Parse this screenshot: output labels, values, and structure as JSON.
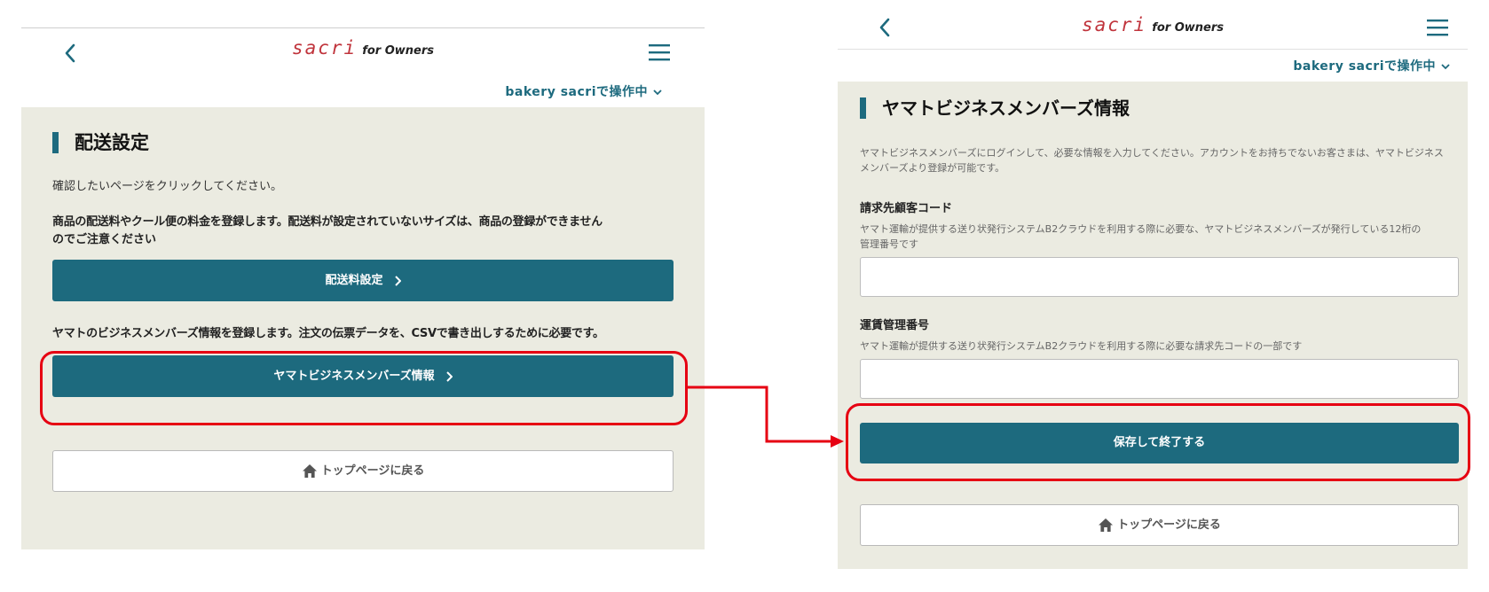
{
  "colors": {
    "accent": "#1d6a7e",
    "brand": "#c0343c",
    "highlight": "#e60012",
    "content_bg": "#ebebe1"
  },
  "header": {
    "brand": "sacri",
    "brand_sub": "for Owners"
  },
  "store": {
    "label": "bakery sacriで操作中"
  },
  "left": {
    "title": "配送設定",
    "instruction": "確認したいページをクリックしてください。",
    "shipping_note_line1": "商品の配送料やクール便の料金を登録します。配送料が設定されていないサイズは、商品の登録ができません",
    "shipping_note_line2": "のでご注意ください",
    "shipping_button": "配送料設定",
    "yamato_note": "ヤマトのビジネスメンバーズ情報を登録します。注文の伝票データを、CSVで書き出しするために必要です。",
    "yamato_button": "ヤマトビジネスメンバーズ情報",
    "top_button": "トップページに戻る"
  },
  "right": {
    "title": "ヤマトビジネスメンバーズ情報",
    "description_line1": "ヤマトビジネスメンバーズにログインして、必要な情報を入力してください。アカウントをお持ちでないお客さまは、ヤマトビジネス",
    "description_line2": "メンバーズより登録が可能です。",
    "field1_label": "請求先顧客コード",
    "field1_help_line1": "ヤマト運輸が提供する送り状発行システムB2クラウドを利用する際に必要な、ヤマトビジネスメンバーズが発行している12桁の",
    "field1_help_line2": "管理番号です",
    "field1_value": "",
    "field2_label": "運賃管理番号",
    "field2_help": "ヤマト運輸が提供する送り状発行システムB2クラウドを利用する際に必要な請求先コードの一部です",
    "field2_value": "",
    "save_button": "保存して終了する",
    "top_button": "トップページに戻る"
  }
}
